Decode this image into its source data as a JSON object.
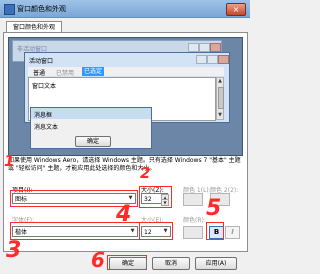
{
  "window": {
    "title": "窗口颜色和外观",
    "close_label": "×"
  },
  "tab": {
    "label": "窗口颜色和外观"
  },
  "preview": {
    "inactive_title": "非活动窗口",
    "active_title": "活动窗口",
    "menu": [
      "普通",
      "已禁用",
      "已选定"
    ],
    "window_text": "窗口文本",
    "message_title": "消息框",
    "message_text": "消息文本",
    "ok_label": "确定"
  },
  "info_text": "如果使用 Windows Aero，请选择 Windows 主题。只有选择 Windows 7 \"基本\" 主题或 \"轻松访问\" 主题，才能应用此处选择的颜色和大小。",
  "item": {
    "label": "项目(I):",
    "value": "图标"
  },
  "size_label": "大小(Z):",
  "size_value": "32",
  "color1_label": "颜色 1(L):",
  "color2_label": "颜色 2(2):",
  "font": {
    "label": "字体(F):",
    "value": "楷体"
  },
  "font_size_label": "大小(E):",
  "font_size_value": "12",
  "font_color_label": "颜色(R):",
  "bold_label": "B",
  "italic_label": "I",
  "buttons": {
    "ok": "确定",
    "cancel": "取消",
    "apply": "应用(A)"
  },
  "annotations": {
    "n1": "1",
    "n2": "2",
    "n3": "3",
    "n4": "4",
    "n5": "5",
    "n6": "6"
  },
  "colors": {
    "annotation": "#ff2a2a",
    "titlebar": "#9fc3e6",
    "preview_bg": "#6b86a6"
  }
}
